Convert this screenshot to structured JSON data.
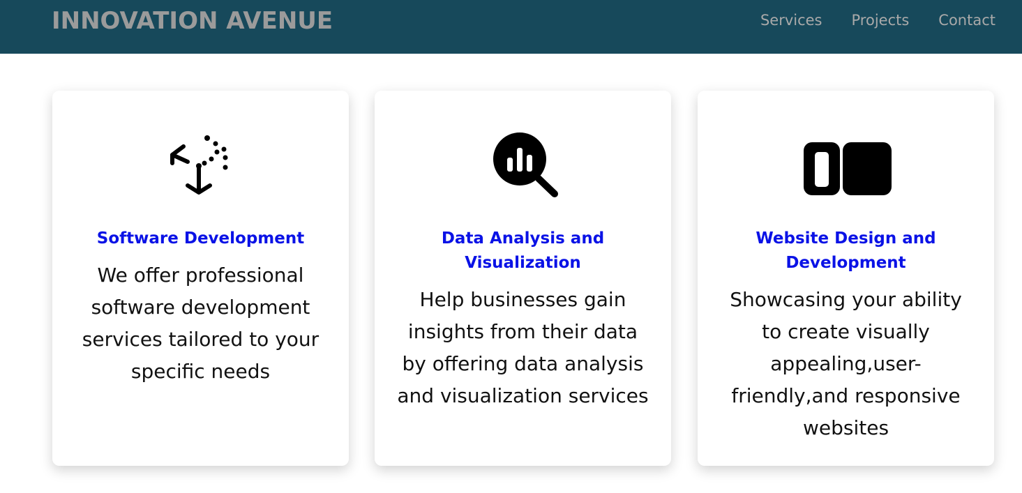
{
  "header": {
    "brand": "INNOVATION AVENUE",
    "nav": [
      "Services",
      "Projects",
      "Contact"
    ]
  },
  "cards": [
    {
      "icon": "code-sandbox-icon",
      "title": "Software Development",
      "text": "We offer professional software development services tailored to your specific needs"
    },
    {
      "icon": "magnifier-chart-icon",
      "title": "Data Analysis and Visualization",
      "text": "Help businesses gain insights from their data by offering data analysis and visualization services"
    },
    {
      "icon": "layout-columns-icon",
      "title": "Website Design and Development",
      "text": "Showcasing your ability to create visually appealing,user-friendly,and responsive websites"
    }
  ],
  "colors": {
    "navbar": "#17495b",
    "brand": "#9b9b9b",
    "nav_link": "#a9a9a9",
    "card_title": "#0a12e6",
    "card_text": "#111111"
  }
}
